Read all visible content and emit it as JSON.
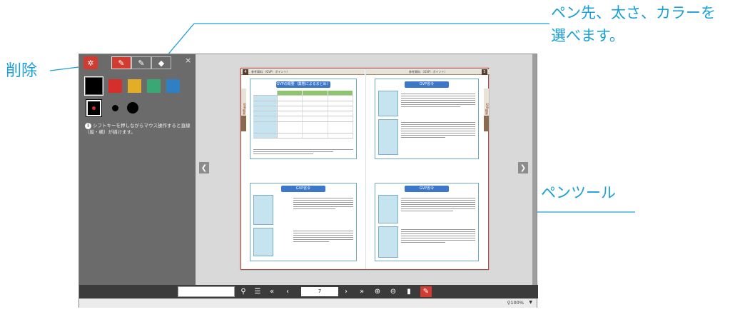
{
  "callouts": {
    "top_line1": "ペン先、太さ、カラーを",
    "top_line2": "選べます。",
    "delete": "削除",
    "pen_tool": "ペンツール"
  },
  "panel": {
    "close": "×",
    "hint": "シフトキーを押しながらマウス操作すると直線（縦・横）が描けます。",
    "colors": [
      "#000000",
      "#d62e2a",
      "#e4ad26",
      "#3aa774",
      "#2f7fc4"
    ],
    "selected_color": "#000000",
    "selected_size": "small",
    "icons": {
      "delete": "sparkle-icon",
      "pen_1": "pen-icon",
      "pen_2": "pen-icon",
      "pen_3": "marker-icon"
    }
  },
  "book": {
    "left_page_num": "4",
    "right_page_num": "5",
    "left_header": "参考資料 〈GVP：ポイント〉",
    "right_header": "参考資料 〈GVP：ポイント〉",
    "left_top_title": "GVPの概要（業態によるまとめ）",
    "left_bottom_title": "GVP省令",
    "right_top_title": "GVP省令",
    "right_bottom_title": "GVP省令",
    "side_tab": "GVP概要"
  },
  "toolbar": {
    "page_value": "7",
    "icons": [
      "search-icon",
      "list-icon",
      "first-page-icon",
      "prev-icon",
      "next-icon",
      "last-page-icon",
      "zoom-in-icon",
      "zoom-out-icon",
      "bookmark-icon",
      "pen-tool-icon"
    ]
  },
  "status": {
    "zoom": "100%",
    "zoom_caret": "▼"
  }
}
